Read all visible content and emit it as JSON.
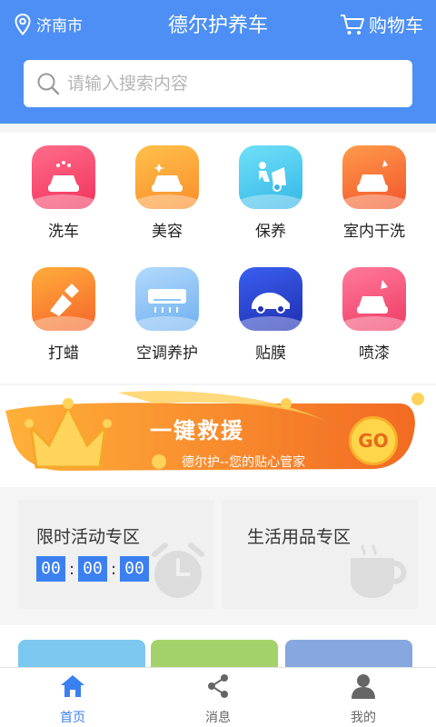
{
  "header": {
    "location": "济南市",
    "title": "德尔护养车",
    "cart_label": "购物车",
    "bg_color": "#4d8ff4"
  },
  "search": {
    "placeholder": "请输入搜索内容"
  },
  "services": [
    {
      "label": "洗车",
      "icon": "car-wash-icon",
      "color": "#f24a6f"
    },
    {
      "label": "美容",
      "icon": "car-beauty-icon",
      "color": "#fba53a"
    },
    {
      "label": "保养",
      "icon": "car-maintenance-icon",
      "color": "#45c7ee"
    },
    {
      "label": "室内干洗",
      "icon": "interior-clean-icon",
      "color": "#fb7a3c"
    },
    {
      "label": "打蜡",
      "icon": "waxing-icon",
      "color": "#fb8a3a"
    },
    {
      "label": "空调养护",
      "icon": "air-conditioner-icon",
      "color": "#8fc4f6"
    },
    {
      "label": "贴膜",
      "icon": "car-film-icon",
      "color": "#2e4fd6"
    },
    {
      "label": "喷漆",
      "icon": "spray-paint-icon",
      "color": "#f45a7a"
    }
  ],
  "banner": {
    "title": "一键救援",
    "subtitle": "德尔护--您的贴心管家",
    "button": "GO"
  },
  "promos": {
    "limited": {
      "title": "限时活动专区",
      "timer": [
        "00",
        "00",
        "00"
      ]
    },
    "living": {
      "title": "生活用品专区"
    }
  },
  "tabs": [
    {
      "label": "首页",
      "icon": "home-icon"
    },
    {
      "label": "消息",
      "icon": "share-icon"
    },
    {
      "label": "我的",
      "icon": "user-icon"
    }
  ],
  "colors": {
    "accent": "#3b80f0"
  }
}
